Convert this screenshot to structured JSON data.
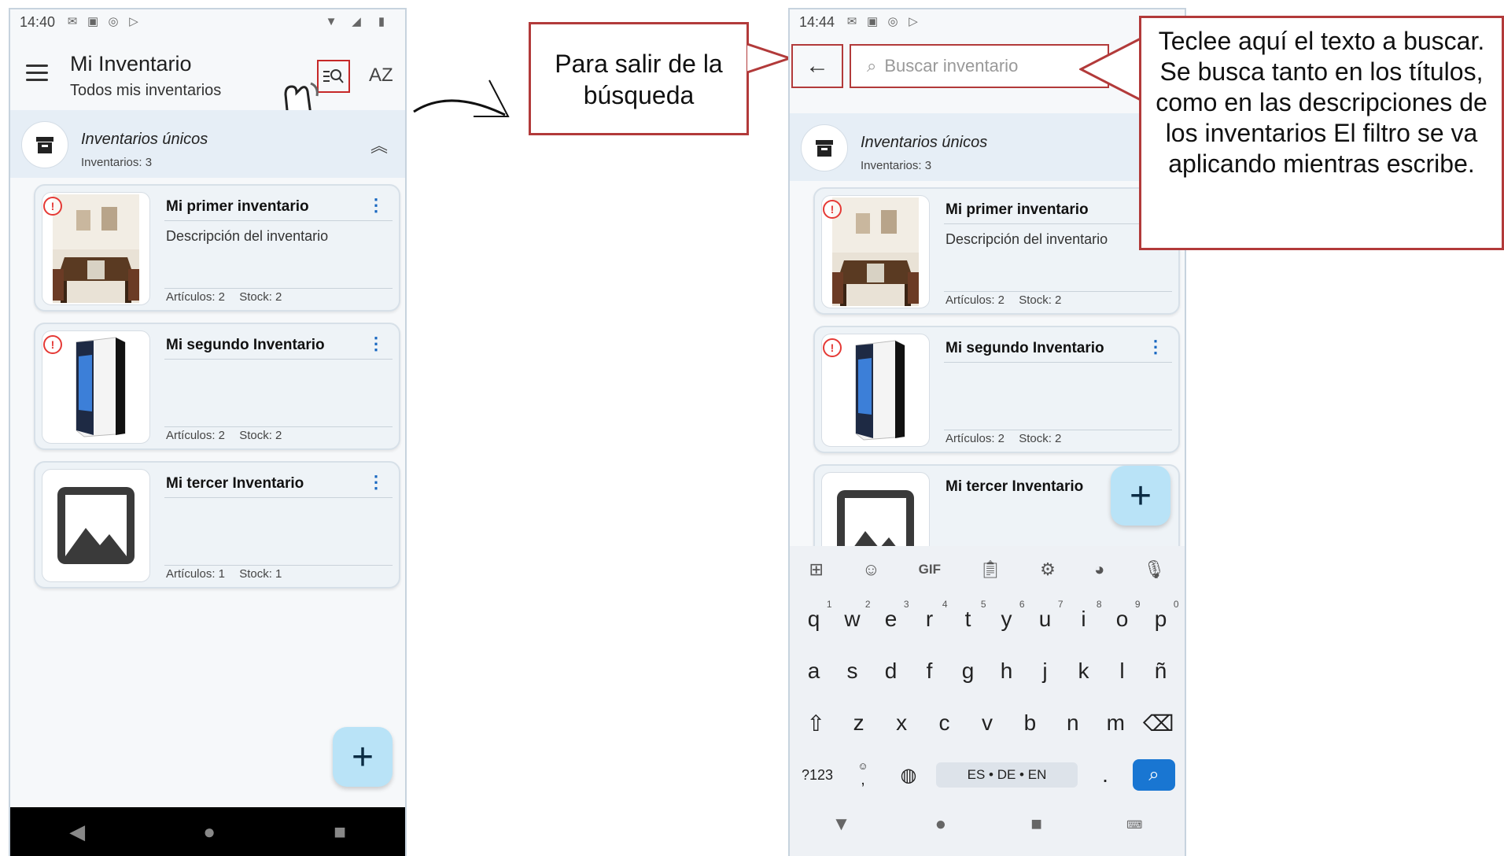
{
  "left_screen": {
    "status_time": "14:40",
    "title": "Mi Inventario",
    "subtitle": "Todos mis inventarios",
    "sort_label": "AZ",
    "group": {
      "title": "Inventarios únicos",
      "count": "Inventarios: 3"
    },
    "cards": [
      {
        "title": "Mi primer inventario",
        "description": "Descripción del inventario",
        "articles": "Artículos: 2",
        "stock": "Stock: 2"
      },
      {
        "title": "Mi segundo Inventario",
        "description": "",
        "articles": "Artículos: 2",
        "stock": "Stock: 2"
      },
      {
        "title": "Mi tercer Inventario",
        "description": "",
        "articles": "Artículos: 1",
        "stock": "Stock: 1"
      }
    ],
    "fab": "+"
  },
  "right_screen": {
    "status_time": "14:44",
    "search_placeholder": "Buscar inventario",
    "group": {
      "title": "Inventarios únicos",
      "count": "Inventarios: 3"
    },
    "cards": [
      {
        "title": "Mi primer inventario",
        "description": "Descripción del inventario",
        "articles": "Artículos: 2",
        "stock": "Stock: 2"
      },
      {
        "title": "Mi segundo Inventario",
        "description": "",
        "articles": "Artículos: 2",
        "stock": "Stock: 2"
      },
      {
        "title": "Mi tercer Inventario",
        "description": "",
        "articles": "",
        "stock": ""
      }
    ],
    "fab": "+",
    "keyboard": {
      "tool_gif": "GIF",
      "row1": [
        "q",
        "w",
        "e",
        "r",
        "t",
        "y",
        "u",
        "i",
        "o",
        "p"
      ],
      "row1_hints": [
        "1",
        "2",
        "3",
        "4",
        "5",
        "6",
        "7",
        "8",
        "9",
        "0"
      ],
      "row2": [
        "a",
        "s",
        "d",
        "f",
        "g",
        "h",
        "j",
        "k",
        "l",
        "ñ"
      ],
      "row3": [
        "z",
        "x",
        "c",
        "v",
        "b",
        "n",
        "m"
      ],
      "symbols": "?123",
      "comma": ",",
      "space": "ES • DE • EN",
      "period": "."
    }
  },
  "callouts": {
    "exit": "Para salir de la búsqueda",
    "search": "Teclee aquí el texto a buscar. Se busca tanto en los títulos, como en las descripciones de los inventarios El filtro se va aplicando mientras escribe."
  },
  "colors": {
    "accent_red": "#b23a3a",
    "fab_bg": "#b9e3f7",
    "kebab": "#1565c0",
    "search_key": "#1976d2"
  }
}
